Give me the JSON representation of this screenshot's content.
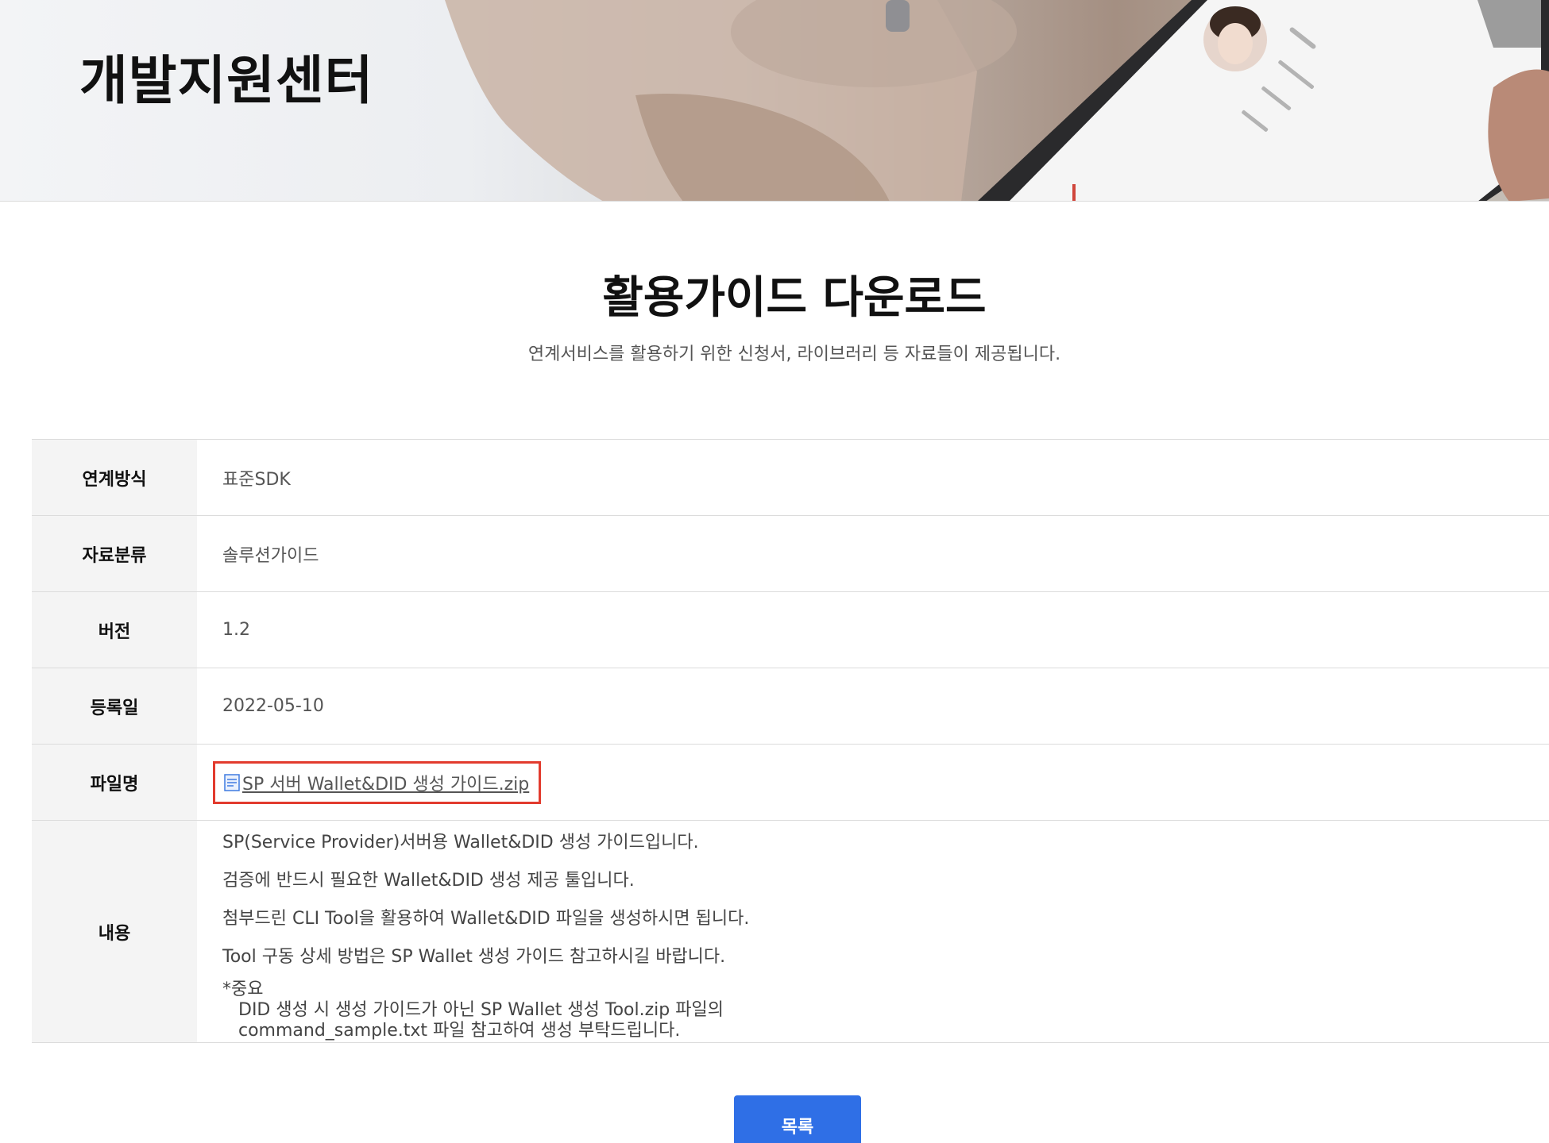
{
  "header": {
    "title": "개발지원센터"
  },
  "page": {
    "heading": "활용가이드 다운로드",
    "subtitle": "연계서비스를 활용하기 위한 신청서, 라이브러리 등 자료들이 제공됩니다."
  },
  "detail": {
    "rows": [
      {
        "label": "연계방식",
        "value": "표준SDK"
      },
      {
        "label": "자료분류",
        "value": "솔루션가이드"
      },
      {
        "label": "버전",
        "value": "1.2"
      },
      {
        "label": "등록일",
        "value": "2022-05-10"
      }
    ],
    "file": {
      "label": "파일명",
      "name": "SP 서버 Wallet&DID 생성 가이드.zip",
      "icon": "document-icon"
    },
    "content": {
      "label": "내용",
      "lines": [
        "SP(Service Provider)서버용 Wallet&DID 생성 가이드입니다.",
        "검증에 반드시 필요한 Wallet&DID 생성 제공 툴입니다.",
        "첨부드린 CLI Tool을 활용하여 Wallet&DID 파일을 생성하시면 됩니다.",
        "Tool 구동 상세 방법은 SP Wallet 생성 가이드 참고하시길 바랍니다."
      ],
      "important_title": "*중요",
      "important_lines": [
        "DID 생성 시 생성 가이드가 아닌 SP Wallet 생성 Tool.zip 파일의",
        "command_sample.txt 파일 참고하여 생성 부탁드립니다."
      ]
    }
  },
  "actions": {
    "list_label": "목록"
  },
  "colors": {
    "accent_button": "#2f6fe6",
    "highlight_border": "#e23b2e",
    "row_header_bg": "#f4f4f4"
  }
}
